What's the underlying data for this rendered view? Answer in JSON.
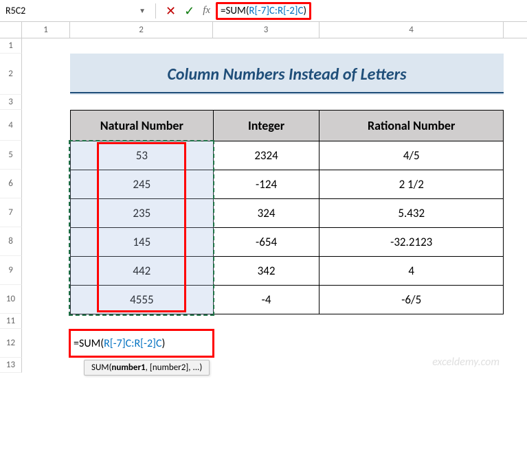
{
  "formula_bar": {
    "cell_ref": "R5C2",
    "formula_prefix": "=SUM(",
    "formula_range": "R[-7]C:R[-2]C",
    "formula_suffix": ")"
  },
  "columns": [
    "1",
    "2",
    "3",
    "4"
  ],
  "rows": [
    "1",
    "2",
    "3",
    "4",
    "5",
    "6",
    "7",
    "8",
    "9",
    "10",
    "11",
    "12",
    "13"
  ],
  "title": "Column Numbers Instead of Letters",
  "table": {
    "headers": [
      "Natural Number",
      "Integer",
      "Rational Number"
    ],
    "data": [
      [
        "53",
        "2324",
        "4/5"
      ],
      [
        "245",
        "-124",
        "2 1/2"
      ],
      [
        "235",
        "324",
        "5.432"
      ],
      [
        "145",
        "-654",
        "-32.2123"
      ],
      [
        "442",
        "342",
        "4"
      ],
      [
        "4555",
        "-4",
        "-6/5"
      ]
    ]
  },
  "cell_formula": {
    "prefix": "=SUM(",
    "range": "R[-7]C:R[-2]C",
    "suffix": ")"
  },
  "tooltip": {
    "fn": "SUM",
    "arg1": "number1",
    "arg2": ", [number2], ..."
  },
  "watermark": "exceldemy.com"
}
